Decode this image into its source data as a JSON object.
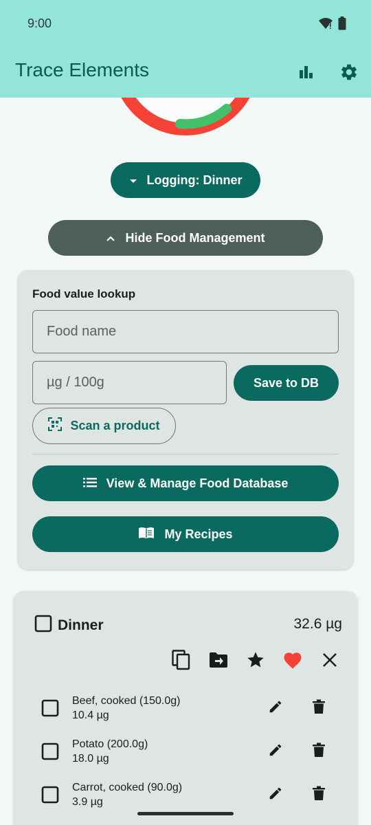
{
  "status_bar": {
    "time": "9:00",
    "icons": [
      "wifi-icon",
      "battery-icon"
    ]
  },
  "app_bar": {
    "title": "Trace Elements",
    "actions": [
      "bar-chart-icon",
      "settings-icon"
    ]
  },
  "progress_ring": {
    "colors": {
      "track": "#f44336",
      "progress": "#43c06a"
    }
  },
  "logging": {
    "label": "Logging: Dinner"
  },
  "food_management": {
    "toggle_label": "Hide Food Management"
  },
  "food_lookup": {
    "heading": "Food value lookup",
    "food_name_placeholder": "Food name",
    "value_placeholder": "µg / 100g",
    "save_label": "Save to DB",
    "scan_label": "Scan a product",
    "view_db_label": "View & Manage Food Database",
    "recipes_label": "My Recipes"
  },
  "meal": {
    "name": "Dinner",
    "total": "32.6 µg",
    "actions": [
      "copy-icon",
      "move-to-folder-icon",
      "star-icon",
      "heart-icon",
      "close-icon"
    ],
    "items": [
      {
        "name": "Beef, cooked (150.0g)",
        "amount": "10.4 µg"
      },
      {
        "name": "Potato (200.0g)",
        "amount": "18.0 µg"
      },
      {
        "name": "Carrot, cooked (90.0g)",
        "amount": "3.9 µg"
      }
    ]
  },
  "colors": {
    "primary": "#0b6a5f",
    "app_bar": "#93e5d9",
    "secondary_button": "#4d5f5b",
    "card": "#dfe5e3",
    "heart": "#f44336"
  }
}
